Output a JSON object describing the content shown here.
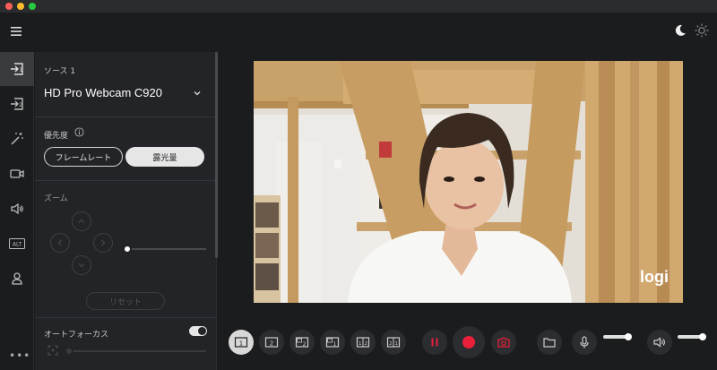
{
  "window": {
    "traffic_colors": [
      "#ff5f57",
      "#febc2e",
      "#28c840"
    ]
  },
  "sidebar": {
    "items": [
      {
        "icon": "source1-icon",
        "active": true
      },
      {
        "icon": "source2-icon",
        "active": false
      },
      {
        "icon": "effects-wand-icon",
        "active": false
      },
      {
        "icon": "camera-icon",
        "active": false
      },
      {
        "icon": "speaker-icon",
        "active": false
      },
      {
        "icon": "alt-icon",
        "label": "ALT",
        "active": false
      },
      {
        "icon": "person-icon",
        "active": false
      }
    ],
    "more_label": "•••"
  },
  "panel": {
    "source_label": "ソース 1",
    "camera_name": "HD Pro Webcam C920",
    "priority_label": "優先度",
    "priority_options": [
      "フレームレート",
      "露光量"
    ],
    "priority_selected": "露光量",
    "zoom_label": "ズーム",
    "zoom_level": 0.0,
    "reset_label": "リセット",
    "autofocus_label": "オートフォーカス",
    "autofocus_on": true,
    "focus_level": 0.0
  },
  "video": {
    "brand": "logi"
  },
  "controls": {
    "layouts": [
      "1",
      "2",
      "1-2-pip",
      "2-1-pip",
      "1-2",
      "2-1"
    ],
    "layout_selected": "1",
    "mic_level": 0.85,
    "speaker_level": 0.85
  },
  "colors": {
    "accent_red": "#e8203a",
    "background": "#1b1c1e",
    "panel": "#232427"
  }
}
